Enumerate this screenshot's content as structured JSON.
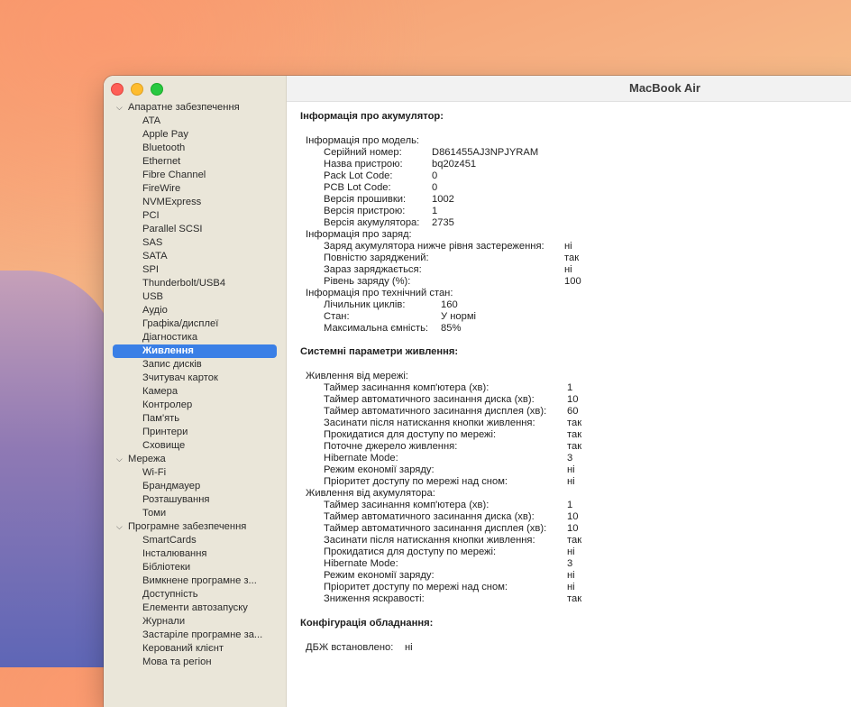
{
  "window": {
    "title": "MacBook Air"
  },
  "sidebar": {
    "hardware": {
      "label": "Апаратне забезпечення",
      "items": [
        "ATA",
        "Apple Pay",
        "Bluetooth",
        "Ethernet",
        "Fibre Channel",
        "FireWire",
        "NVMExpress",
        "PCI",
        "Parallel SCSI",
        "SAS",
        "SATA",
        "SPI",
        "Thunderbolt/USB4",
        "USB",
        "Аудіо",
        "Графіка/дисплеї",
        "Діагностика",
        "Живлення",
        "Запис дисків",
        "Зчитувач карток",
        "Камера",
        "Контролер",
        "Пам'ять",
        "Принтери",
        "Сховище"
      ],
      "selected": "Живлення"
    },
    "network": {
      "label": "Мережа",
      "items": [
        "Wi-Fi",
        "Брандмауер",
        "Розташування",
        "Томи"
      ]
    },
    "software": {
      "label": "Програмне забезпечення",
      "items": [
        "SmartCards",
        "Інсталювання",
        "Бібліотеки",
        "Вимкнене програмне з...",
        "Доступність",
        "Елементи автозапуску",
        "Журнали",
        "Застаріле програмне за...",
        "Керований клієнт",
        "Мова та регіон"
      ]
    }
  },
  "battery": {
    "header": "Інформація про акумулятор:",
    "model": {
      "label": "Інформація про модель:",
      "rows": [
        {
          "k": "Серійний номер:",
          "v": "D861455AJ3NPJYRAM"
        },
        {
          "k": "Назва пристрою:",
          "v": "bq20z451"
        },
        {
          "k": "Pack Lot Code:",
          "v": "0"
        },
        {
          "k": "PCB Lot Code:",
          "v": "0"
        },
        {
          "k": "Версія прошивки:",
          "v": "1002"
        },
        {
          "k": "Версія пристрою:",
          "v": "1"
        },
        {
          "k": "Версія акумулятора:",
          "v": "2735"
        }
      ]
    },
    "charge": {
      "label": "Інформація про заряд:",
      "rows": [
        {
          "k": "Заряд акумулятора нижче рівня застереження:",
          "v": "ні"
        },
        {
          "k": "Повністю заряджений:",
          "v": "так"
        },
        {
          "k": "Зараз заряджається:",
          "v": "ні"
        },
        {
          "k": "Рівень заряду (%):",
          "v": "100"
        }
      ]
    },
    "health": {
      "label": "Інформація про технічний стан:",
      "rows": [
        {
          "k": "Лічильник циклів:",
          "v": "160"
        },
        {
          "k": "Стан:",
          "v": "У нормі"
        },
        {
          "k": "Максимальна ємність:",
          "v": "85%"
        }
      ]
    }
  },
  "power": {
    "header": "Системні параметри живлення:",
    "ac": {
      "label": "Живлення від мережі:",
      "rows": [
        {
          "k": "Таймер засинання комп'ютера (хв):",
          "v": "1"
        },
        {
          "k": "Таймер автоматичного засинання диска (хв):",
          "v": "10"
        },
        {
          "k": "Таймер автоматичного засинання дисплея (хв):",
          "v": "60"
        },
        {
          "k": "Засинати після натискання кнопки живлення:",
          "v": "так"
        },
        {
          "k": "Прокидатися для доступу по мережі:",
          "v": "так"
        },
        {
          "k": "Поточне джерело живлення:",
          "v": "так"
        },
        {
          "k": "Hibernate Mode:",
          "v": "3"
        },
        {
          "k": "Режим економії заряду:",
          "v": "ні"
        },
        {
          "k": "Пріоритет доступу по мережі над сном:",
          "v": "ні"
        }
      ]
    },
    "battery": {
      "label": "Живлення від акумулятора:",
      "rows": [
        {
          "k": "Таймер засинання комп'ютера (хв):",
          "v": "1"
        },
        {
          "k": "Таймер автоматичного засинання диска (хв):",
          "v": "10"
        },
        {
          "k": "Таймер автоматичного засинання дисплея (хв):",
          "v": "10"
        },
        {
          "k": "Засинати після натискання кнопки живлення:",
          "v": "так"
        },
        {
          "k": "Прокидатися для доступу по мережі:",
          "v": "ні"
        },
        {
          "k": "Hibernate Mode:",
          "v": "3"
        },
        {
          "k": "Режим економії заряду:",
          "v": "ні"
        },
        {
          "k": "Пріоритет доступу по мережі над сном:",
          "v": "ні"
        },
        {
          "k": "Зниження яскравості:",
          "v": "так"
        }
      ]
    }
  },
  "hardware_config": {
    "header": "Конфігурація обладнання:",
    "ups_label": "ДБЖ встановлено:",
    "ups_value": "ні"
  }
}
